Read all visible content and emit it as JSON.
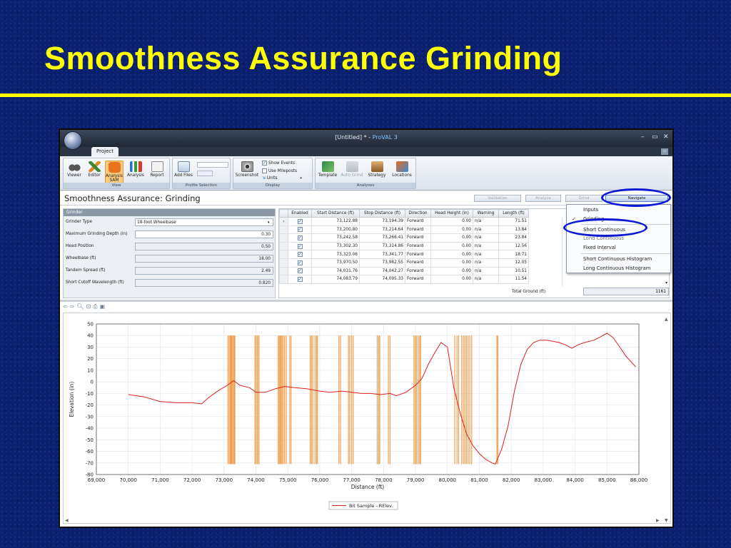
{
  "slide": {
    "title": "Smoothness Assurance Grinding"
  },
  "window": {
    "title_doc": "[Untitled] * - ",
    "title_app": "ProVAL 3",
    "controls": [
      "–",
      "▭",
      "✕"
    ]
  },
  "ribbon": {
    "tab": "Project",
    "groups": {
      "view": "View",
      "profile_selection": "Profile Selection",
      "display": "Display",
      "analyses": "Analyses"
    },
    "buttons": {
      "viewer": "Viewer",
      "editor": "Editor",
      "analysis_sam": "Analysis\nSAM",
      "analysis": "Analysis",
      "report": "Report",
      "add_files": "Add Files",
      "screenshot": "Screenshot",
      "template": "Template",
      "auto_grind": "Auto Grind",
      "strategy": "Strategy",
      "locations": "Locations"
    },
    "display_options": {
      "show_events": "Show Events",
      "use_mileposts": "Use Mileposts",
      "units": "Units"
    }
  },
  "sam": {
    "title": "Smoothness Assurance: Grinding",
    "toolbar": {
      "validation": "Validation",
      "analyze": "Analyze",
      "grind": "Grind",
      "navigate": "Navigate"
    }
  },
  "grinder": {
    "header": "Grinder",
    "params": [
      {
        "label": "Grinder Type",
        "value": "18-foot Wheelbase"
      },
      {
        "label": "Maximum Grinding Depth (in)",
        "value": "0.30"
      },
      {
        "label": "Head Position",
        "value": "0.50"
      },
      {
        "label": "Wheelbase (ft)",
        "value": "18.00"
      },
      {
        "label": "Tandem Spread (ft)",
        "value": "2.49"
      },
      {
        "label": "Short Cutoff Wavelength (ft)",
        "value": "0.820"
      }
    ]
  },
  "grid": {
    "columns": [
      "Enabled",
      "Start Distance (ft)",
      "Stop Distance (ft)",
      "Direction",
      "Head Height (in)",
      "Warning",
      "Length (ft)"
    ],
    "rows": [
      [
        "73,122.88",
        "73,194.39",
        "Forward",
        "0.00",
        "n/a",
        "71.51"
      ],
      [
        "73,200.80",
        "73,214.64",
        "Forward",
        "0.00",
        "n/a",
        "13.84"
      ],
      [
        "73,242.58",
        "73,266.41",
        "Forward",
        "0.00",
        "n/a",
        "23.84"
      ],
      [
        "73,302.30",
        "73,314.86",
        "Forward",
        "0.00",
        "n/a",
        "12.56"
      ],
      [
        "73,323.06",
        "73,341.77",
        "Forward",
        "0.00",
        "n/a",
        "18.71"
      ],
      [
        "73,970.50",
        "73,982.55",
        "Forward",
        "0.00",
        "n/a",
        "12.05"
      ],
      [
        "74,031.76",
        "74,042.27",
        "Forward",
        "0.00",
        "n/a",
        "10.51"
      ],
      [
        "74,083.79",
        "74,095.33",
        "Forward",
        "0.00",
        "n/a",
        "11.54"
      ]
    ],
    "total_label": "Total Ground (ft)",
    "total_value": "1161"
  },
  "navigate_menu": {
    "items": [
      "Inputs",
      "Grinding",
      "Short Continuous",
      "Long Continuous",
      "Fixed Interval",
      "Short Continuous Histogram",
      "Long Continuous Histogram"
    ],
    "checked": "Grinding"
  },
  "chart_data": {
    "type": "line",
    "xlabel": "Distance (ft)",
    "ylabel": "Elevation (in)",
    "xlim": [
      69000,
      86000
    ],
    "ylim": [
      -80,
      50
    ],
    "xticks": [
      "69,000",
      "70,000",
      "71,000",
      "72,000",
      "73,000",
      "74,000",
      "75,000",
      "76,000",
      "77,000",
      "78,000",
      "79,000",
      "80,000",
      "81,000",
      "82,000",
      "83,000",
      "84,000",
      "85,000",
      "86,000"
    ],
    "yticks": [
      "50",
      "40",
      "30",
      "20",
      "10",
      "0",
      "-10",
      "-20",
      "-30",
      "-40",
      "-50",
      "-60",
      "-70",
      "-80"
    ],
    "legend": "top",
    "series": [
      {
        "name": "Bit Sample - RElev.",
        "color": "#e02020",
        "x": [
          70000,
          70500,
          71000,
          71500,
          72000,
          72300,
          72500,
          72800,
          73100,
          73300,
          73500,
          73800,
          74000,
          74300,
          74600,
          74900,
          75200,
          75600,
          76000,
          76300,
          76700,
          77000,
          77300,
          77600,
          77900,
          78200,
          78400,
          78700,
          79000,
          79200,
          79400,
          79600,
          79800,
          80000,
          80200,
          80400,
          80600,
          80800,
          81000,
          81200,
          81400,
          81500,
          81700,
          81900,
          82100,
          82300,
          82500,
          82700,
          82900,
          83100,
          83300,
          83500,
          83700,
          83900,
          84100,
          84300,
          84600,
          84800,
          85000,
          85200,
          85400,
          85600,
          85900
        ],
        "y": [
          -11,
          -13,
          -17,
          -18,
          -18,
          -19,
          -14,
          -8,
          -3,
          1,
          -3,
          -5,
          -9,
          -9,
          -6,
          -4,
          -5,
          -6,
          -8,
          -9,
          -8,
          -9,
          -10,
          -10,
          -11,
          -10,
          -12,
          -9,
          -3,
          3,
          15,
          25,
          34,
          30,
          -5,
          -27,
          -45,
          -55,
          -62,
          -67,
          -70,
          -71,
          -58,
          -38,
          -8,
          15,
          28,
          34,
          36,
          36,
          35,
          34,
          32,
          29,
          32,
          34,
          36,
          39,
          42,
          38,
          30,
          22,
          13
        ]
      },
      {
        "name": "grinding locations",
        "color": "#f0a050",
        "x": [
          73122,
          73160,
          73194,
          73200,
          73214,
          73242,
          73266,
          73302,
          73314,
          73323,
          73341,
          73970,
          73982,
          74031,
          74042,
          74083,
          74095,
          74700,
          74730,
          74760,
          74790,
          74820,
          74860,
          74900,
          74950,
          75060,
          75100,
          75700,
          75740,
          75780,
          75850,
          75900,
          75930,
          76600,
          76650,
          76900,
          76940,
          77000,
          77050,
          77800,
          77850,
          77880,
          78150,
          78200,
          78950,
          78990,
          79030,
          79080,
          79130,
          79160,
          80230,
          80300,
          80350,
          80450,
          80500,
          80550,
          80600,
          80650,
          80700,
          80760,
          81550,
          81580
        ]
      }
    ]
  }
}
